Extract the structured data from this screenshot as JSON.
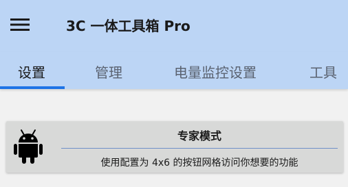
{
  "app": {
    "title": "3C 一体工具箱 Pro",
    "menu_icon": "hamburger-menu-icon"
  },
  "tabs": [
    {
      "label": "设置",
      "selected": true
    },
    {
      "label": "管理",
      "selected": false
    },
    {
      "label": "电量监控设置",
      "selected": false
    },
    {
      "label": "工具",
      "selected": false
    }
  ],
  "colors": {
    "appbar": "#bcd5f5",
    "tab_indicator": "#1e73e6",
    "background": "#f1f1f1",
    "card": "#d8d9d8"
  },
  "card": {
    "icon": "android-icon",
    "title": "专家模式",
    "description": "使用配置为 4x6 的按钮网格访问你想要的功能"
  }
}
